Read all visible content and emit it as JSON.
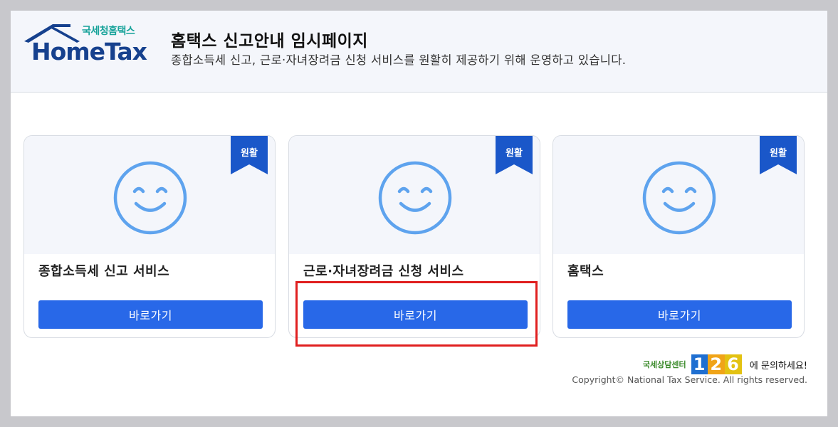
{
  "logo": {
    "brand_kr": "국세청홈택스",
    "brand_en": "HomeTax"
  },
  "header": {
    "title": "홈택스 신고안내 임시페이지",
    "subtitle": "종합소득세 신고, 근로·자녀장려금 신청 서비스를 원활히 제공하기 위해 운영하고 있습니다."
  },
  "cards": [
    {
      "status": "원활",
      "title": "종합소득세 신고 서비스",
      "button": "바로가기",
      "icon": "smiley-icon"
    },
    {
      "status": "원활",
      "title": "근로·자녀장려금 신청 서비스",
      "button": "바로가기",
      "icon": "smiley-icon"
    },
    {
      "status": "원활",
      "title": "홈택스",
      "button": "바로가기",
      "icon": "smiley-icon"
    }
  ],
  "footer": {
    "help_prefix": "국세상담센터",
    "help_number": "126",
    "help_suffix": "에 문의하세요!",
    "copyright": "Copyright© National Tax Service. All rights reserved."
  },
  "colors": {
    "accent": "#2868e8",
    "ribbon": "#1a57c9",
    "smiley": "#5ea3ee",
    "highlight": "#e01f1f"
  }
}
